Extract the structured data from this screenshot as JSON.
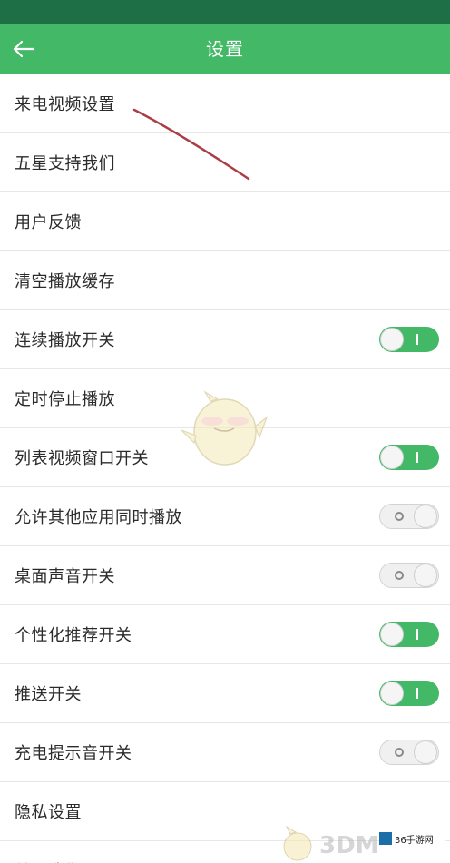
{
  "header": {
    "title": "设置",
    "back_icon": "arrow-left-icon",
    "bar_color": "#43b968",
    "status_color": "#1f6f46"
  },
  "settings": [
    {
      "label": "来电视频设置",
      "type": "link"
    },
    {
      "label": "五星支持我们",
      "type": "link"
    },
    {
      "label": "用户反馈",
      "type": "link"
    },
    {
      "label": "清空播放缓存",
      "type": "link"
    },
    {
      "label": "连续播放开关",
      "type": "toggle",
      "on": true
    },
    {
      "label": "定时停止播放",
      "type": "link"
    },
    {
      "label": "列表视频窗口开关",
      "type": "toggle",
      "on": true
    },
    {
      "label": "允许其他应用同时播放",
      "type": "toggle",
      "on": false
    },
    {
      "label": "桌面声音开关",
      "type": "toggle",
      "on": false
    },
    {
      "label": "个性化推荐开关",
      "type": "toggle",
      "on": true
    },
    {
      "label": "推送开关",
      "type": "toggle",
      "on": true
    },
    {
      "label": "充电提示音开关",
      "type": "toggle",
      "on": false
    },
    {
      "label": "隐私设置",
      "type": "link"
    },
    {
      "label": "关于我们",
      "type": "link"
    }
  ],
  "watermark": {
    "brand": "3DM",
    "site_badge": "36手游网"
  },
  "colors": {
    "toggle_on": "#43b968",
    "toggle_off": "#f0f0f0"
  }
}
